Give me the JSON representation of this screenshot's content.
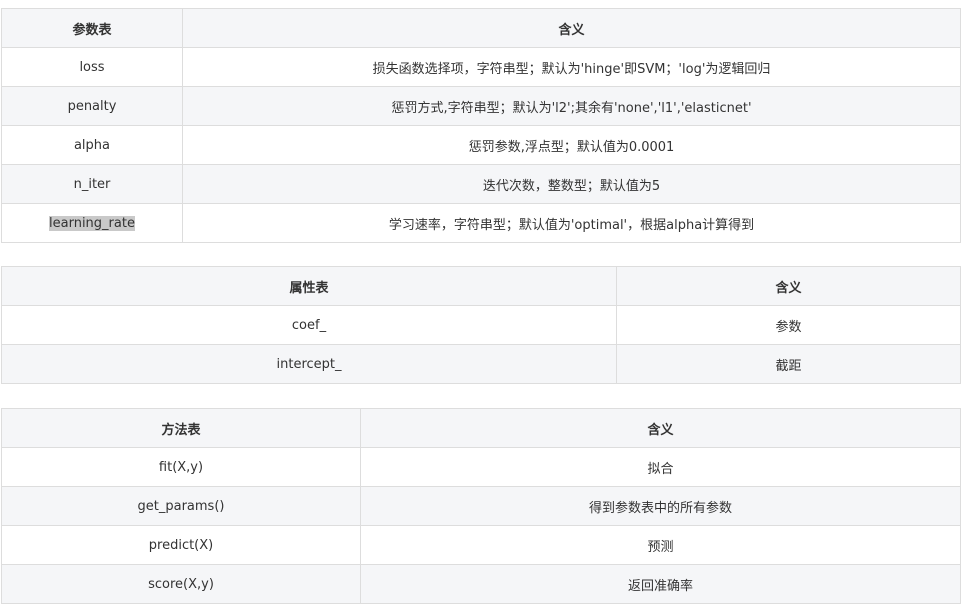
{
  "params_table": {
    "headers": [
      "参数表",
      "含义"
    ],
    "rows": [
      [
        "loss",
        "损失函数选择项，字符串型；默认为'hinge'即SVM；'log'为逻辑回归"
      ],
      [
        "penalty",
        "惩罚方式,字符串型；默认为'l2';其余有'none','l1','elasticnet'"
      ],
      [
        "alpha",
        "惩罚参数,浮点型；默认值为0.0001"
      ],
      [
        "n_iter",
        "迭代次数，整数型；默认值为5"
      ],
      [
        "learning_rate",
        "学习速率，字符串型；默认值为'optimal'，根据alpha计算得到"
      ]
    ]
  },
  "attrs_table": {
    "headers": [
      "属性表",
      "含义"
    ],
    "rows": [
      [
        "coef_",
        "参数"
      ],
      [
        "intercept_",
        "截距"
      ]
    ]
  },
  "methods_table": {
    "headers": [
      "方法表",
      "含义"
    ],
    "rows": [
      [
        "fit(X,y)",
        "拟合"
      ],
      [
        "get_params()",
        "得到参数表中的所有参数"
      ],
      [
        "predict(X)",
        "预测"
      ],
      [
        "score(X,y)",
        "返回准确率"
      ]
    ]
  }
}
